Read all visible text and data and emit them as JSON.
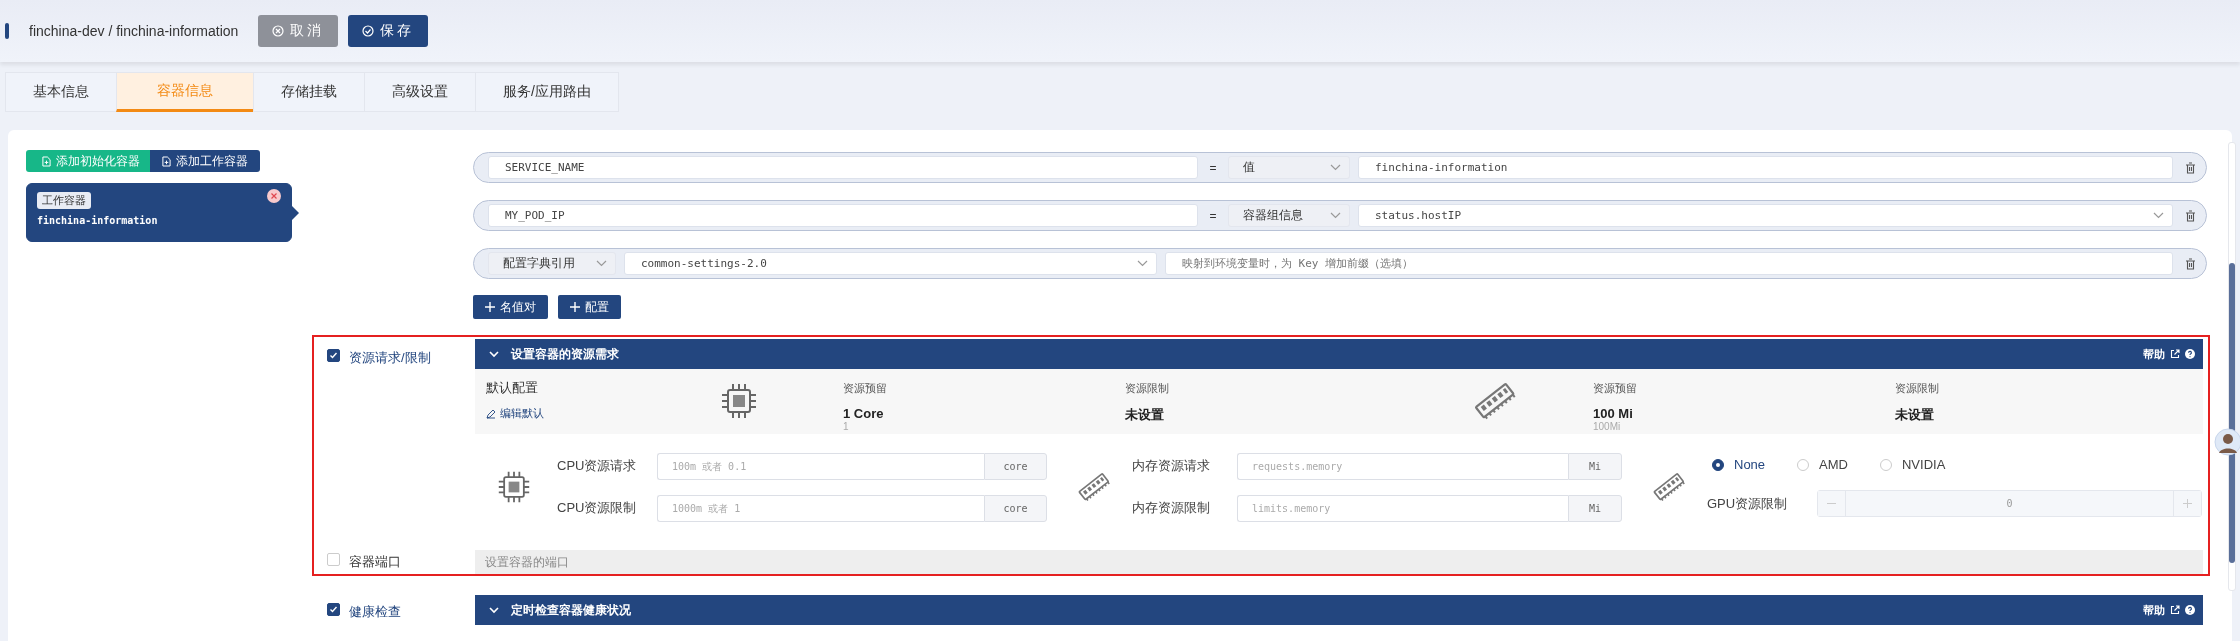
{
  "header": {
    "breadcrumb": "finchina-dev / finchina-information",
    "buttons": [
      {
        "label": "取消",
        "kind": "cancel"
      },
      {
        "label": "保存",
        "kind": "save"
      }
    ]
  },
  "tabs": [
    {
      "label": "基本信息",
      "selected": false
    },
    {
      "label": "容器信息",
      "selected": true
    },
    {
      "label": "存储挂载",
      "selected": false
    },
    {
      "label": "高级设置",
      "selected": false
    },
    {
      "label": "服务/应用路由",
      "selected": false
    }
  ],
  "containers": {
    "buttons": [
      {
        "label": "添加初始化容器",
        "kind": "init"
      },
      {
        "label": "添加工作容器",
        "kind": "work"
      }
    ],
    "items": [
      {
        "tag": "工作容器",
        "name": "finchina-information",
        "selected": true
      }
    ]
  },
  "env": {
    "rows": [
      {
        "kind": "text_pair",
        "key": "SERVICE_NAME",
        "operator": "=",
        "source": "值",
        "value": "finchina-information"
      },
      {
        "kind": "select_pair",
        "key": "MY_POD_IP",
        "operator": "=",
        "source": "容器组信息",
        "value": "status.hostIP"
      },
      {
        "kind": "configmap",
        "source": "配置字典引用",
        "value": "common-settings-2.0",
        "placeholder": "映射到环境变量时，为 Key 增加前缀（选填）"
      }
    ],
    "buttons": [
      "名值对",
      "配置"
    ]
  },
  "sections": [
    {
      "kind": "resources",
      "label": "资源请求/限制",
      "checked": true,
      "highlighted": true,
      "expanded": true,
      "title": "设置容器的资源需求",
      "help": "帮助",
      "defaults": {
        "title": "默认配置",
        "edit": "编辑默认",
        "groups": [
          {
            "kind": "cpu",
            "request_label": "资源预留",
            "request": "1 Core",
            "request_raw": "1",
            "limit_label": "资源限制",
            "limit": "未设置"
          },
          {
            "kind": "memory",
            "request_label": "资源预留",
            "request": "100 Mi",
            "request_raw": "100Mi",
            "limit_label": "资源限制",
            "limit": "未设置"
          }
        ]
      },
      "form": {
        "groups": [
          {
            "kind": "cpu",
            "fields": [
              {
                "label": "CPU资源请求",
                "placeholder": "100m 或者 0.1",
                "unit": "core"
              },
              {
                "label": "CPU资源限制",
                "placeholder": "1000m 或者 1",
                "unit": "core"
              }
            ]
          },
          {
            "kind": "memory",
            "fields": [
              {
                "label": "内存资源请求",
                "placeholder": "requests.memory",
                "unit": "Mi"
              },
              {
                "label": "内存资源限制",
                "placeholder": "limits.memory",
                "unit": "Mi"
              }
            ]
          }
        ],
        "gpu": {
          "options": [
            {
              "label": "None",
              "selected": true
            },
            {
              "label": "AMD",
              "selected": false
            },
            {
              "label": "NVIDIA",
              "selected": false
            }
          ],
          "limit_label": "GPU资源限制",
          "value": "0"
        }
      }
    },
    {
      "kind": "port",
      "label": "容器端口",
      "checked": false,
      "highlighted": true,
      "hint": "设置容器的端口"
    },
    {
      "kind": "health",
      "label": "健康检查",
      "checked": true,
      "highlighted": false,
      "expanded": true,
      "title": "定时检查容器健康状况",
      "help": "帮助"
    }
  ]
}
